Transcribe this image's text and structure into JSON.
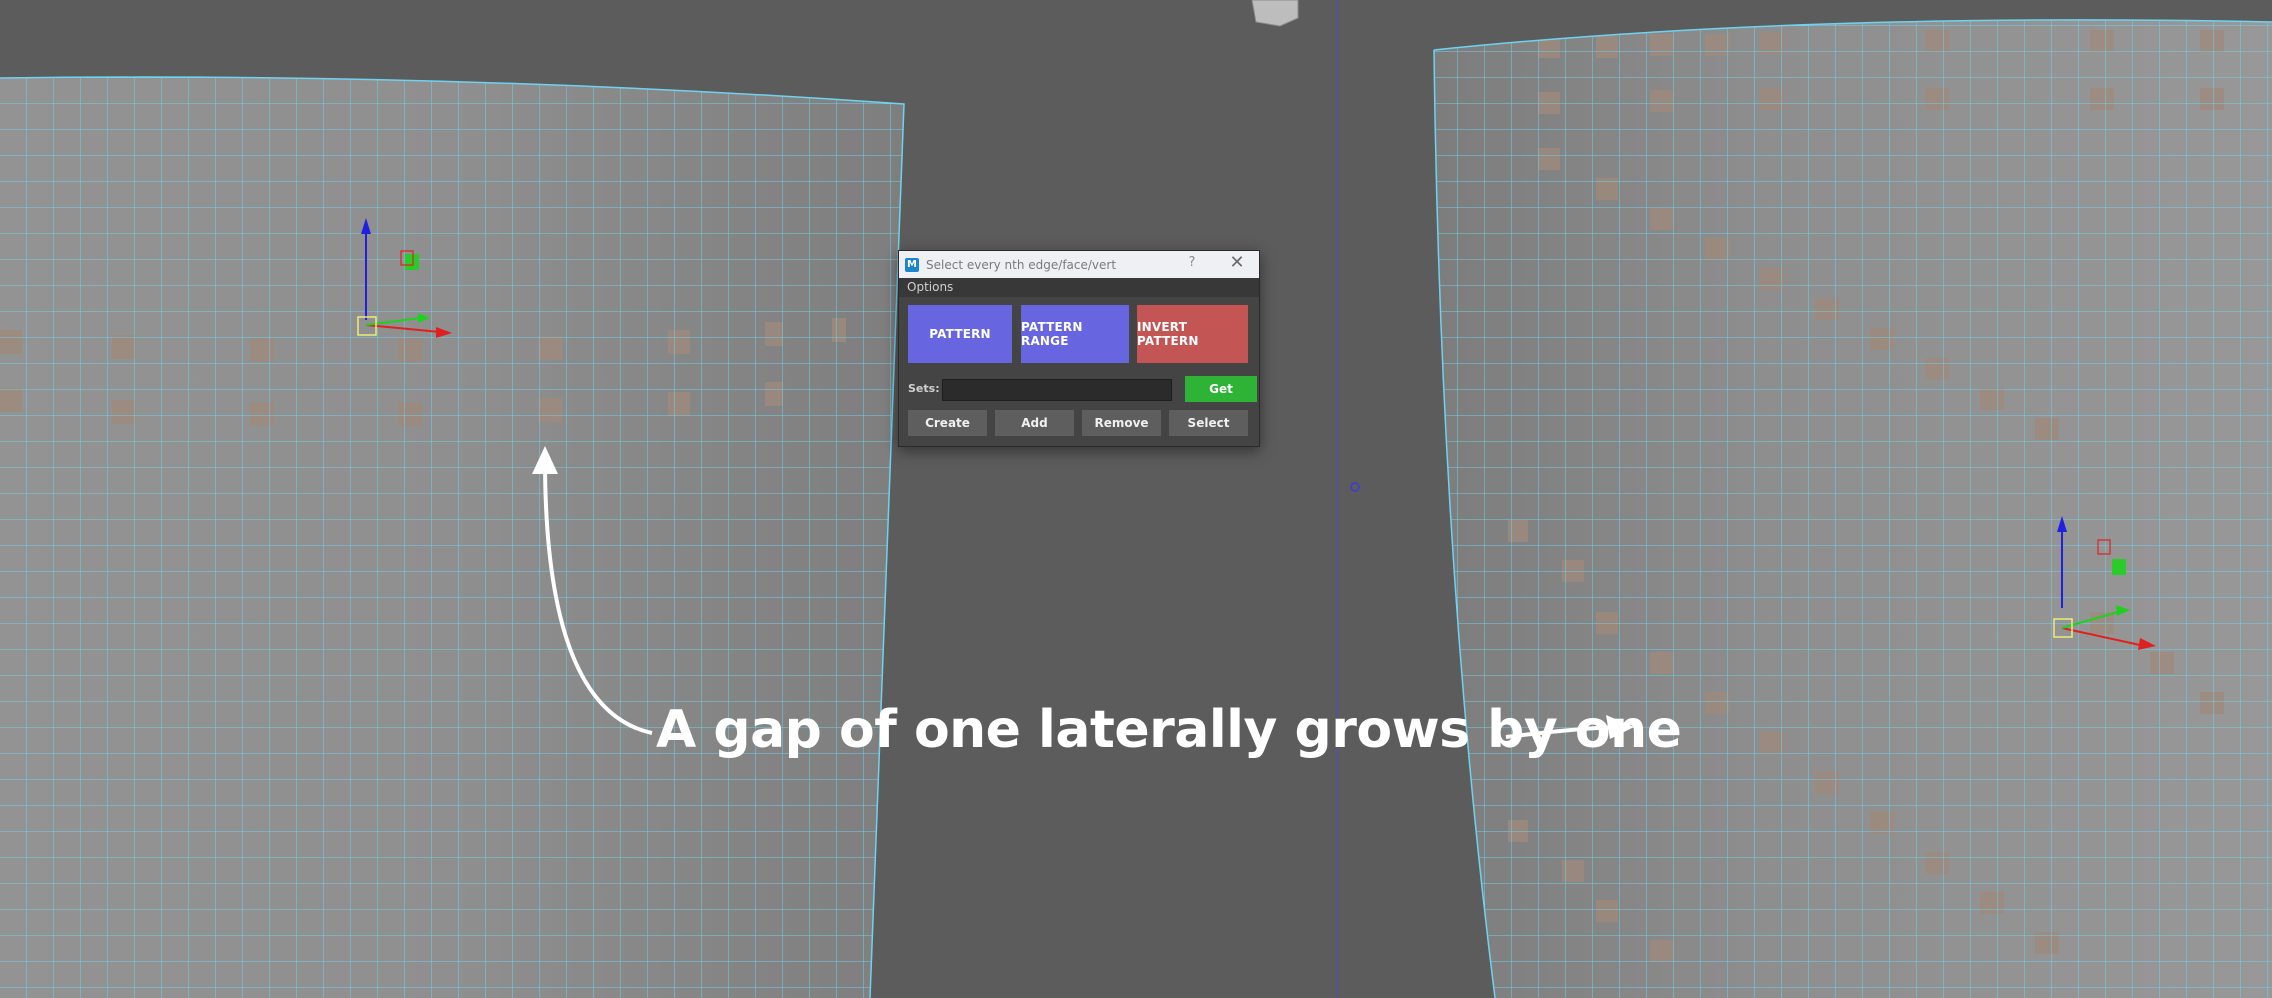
{
  "dialog": {
    "title": "Select every nth edge/face/vert",
    "help_label": "?",
    "close_label": "✕",
    "app_icon_label": "M",
    "menu_label": "Options",
    "pattern_label": "PATTERN",
    "pattern_range_label": "PATTERN RANGE",
    "invert_pattern_label": "INVERT PATTERN",
    "sets_label": "Sets:",
    "sets_value": "",
    "get_label": "Get",
    "create_label": "Create",
    "add_label": "Add",
    "remove_label": "Remove",
    "select_label": "Select"
  },
  "annotation": {
    "caption": "A gap of one laterally grows by one"
  },
  "colors": {
    "viewport": "#5c5c5c",
    "mesh_surface": "#8d8d8d",
    "wireframe": "#6fd3f0",
    "selected_face": "#9e8a7c",
    "pattern_button": "#6766e0",
    "invert_button": "#c35555",
    "get_button": "#2fb336"
  },
  "icons": [
    "manipulator-gizmo-icon",
    "view-cube-icon",
    "app-logo-icon",
    "help-icon",
    "close-icon",
    "arrow-icon"
  ]
}
